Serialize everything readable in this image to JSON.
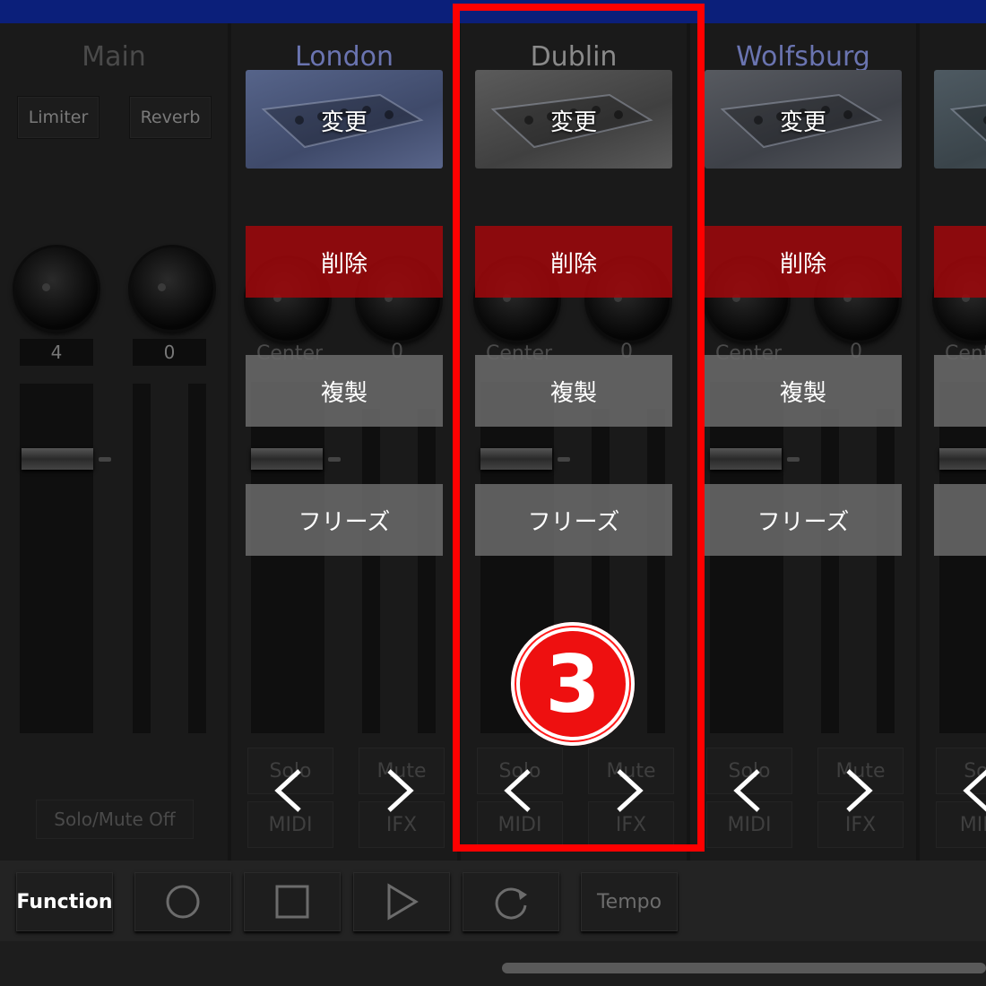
{
  "window": {
    "accent": "#0b1f7a"
  },
  "main": {
    "title": "Main",
    "limiter_label": "Limiter",
    "reverb_label": "Reverb",
    "knob1_value": "4",
    "knob2_value": "0",
    "solo_mute_off_label": "Solo/Mute Off"
  },
  "strips": [
    {
      "title": "London",
      "change": "変更",
      "delete": "削除",
      "duplicate": "複製",
      "freeze": "フリーズ",
      "pan": "Center",
      "vol": "0",
      "solo": "Solo",
      "mute": "Mute",
      "midi": "MIDI",
      "ifx": "IFX"
    },
    {
      "title": "Dublin",
      "change": "変更",
      "delete": "削除",
      "duplicate": "複製",
      "freeze": "フリーズ",
      "pan": "Center",
      "vol": "0",
      "solo": "Solo",
      "mute": "Mute",
      "midi": "MIDI",
      "ifx": "IFX"
    },
    {
      "title": "Wolfsburg",
      "change": "変更",
      "delete": "削除",
      "duplicate": "複製",
      "freeze": "フリーズ",
      "pan": "Center",
      "vol": "0",
      "solo": "Solo",
      "mute": "Mute",
      "midi": "MIDI",
      "ifx": "IFX"
    },
    {
      "title": "",
      "change": "",
      "delete": "",
      "duplicate": "",
      "freeze": "",
      "pan": "Cent",
      "vol": "",
      "solo": "Sol",
      "mute": "",
      "midi": "MID",
      "ifx": ""
    }
  ],
  "toolbar": {
    "function_label": "Function",
    "tempo_label": "Tempo",
    "icons": [
      "record-icon",
      "stop-icon",
      "play-icon",
      "loop-icon"
    ]
  },
  "annotation": {
    "badge_number": "3",
    "color": "#ff0000"
  }
}
